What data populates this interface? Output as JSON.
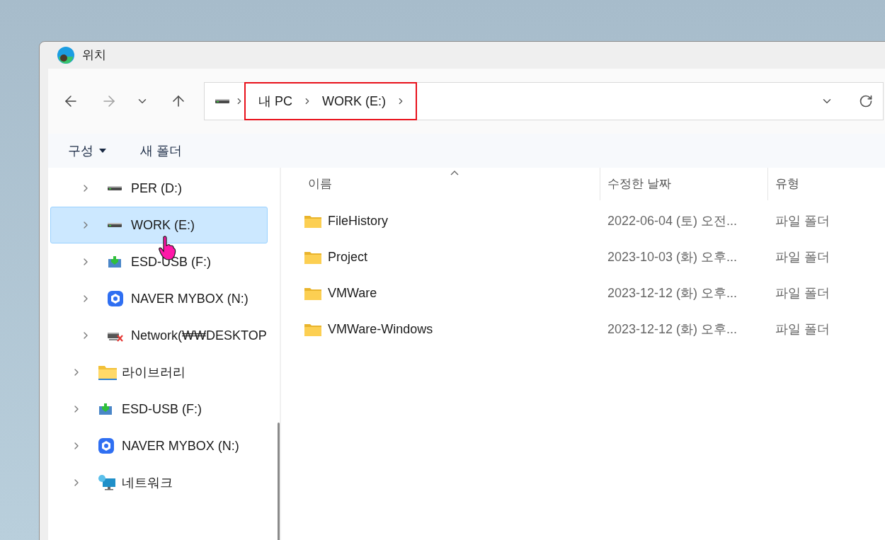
{
  "window": {
    "title": "위치"
  },
  "nav": {
    "back": {
      "disabled": false
    },
    "forward": {
      "disabled": true
    }
  },
  "address_bar": {
    "crumbs": [
      "내 PC",
      "WORK (E:)"
    ]
  },
  "toolbar": {
    "buttons": [
      {
        "label": "구성",
        "kind": "menu"
      },
      {
        "label": "새 폴더",
        "kind": "plain"
      }
    ]
  },
  "sidebar": {
    "items": [
      {
        "children": [
          {
            "label": "PER (D:)",
            "kind": "drive",
            "selected": false,
            "expanded": false
          },
          {
            "label": "WORK (E:)",
            "kind": "drive",
            "selected": true,
            "expanded": false
          },
          {
            "label": "ESD-USB (F:)",
            "kind": "usb",
            "selected": false,
            "expanded": false
          },
          {
            "label": "NAVER MYBOX (N:)",
            "kind": "cloud",
            "selected": false,
            "expanded": false
          },
          {
            "label": "Network(₩₩DESKTOP",
            "kind": "network-drive",
            "selected": false,
            "expanded": false
          }
        ]
      },
      {
        "label": "라이브러리",
        "kind": "library",
        "selected": false,
        "expanded": false
      },
      {
        "label": "ESD-USB (F:)",
        "kind": "usb",
        "selected": false,
        "expanded": false
      },
      {
        "label": "NAVER MYBOX (N:)",
        "kind": "cloud",
        "selected": false,
        "expanded": false
      },
      {
        "label": "네트워크",
        "kind": "network",
        "selected": false,
        "expanded": false
      }
    ]
  },
  "table": {
    "columns": [
      {
        "label": "이름",
        "sorted": true
      },
      {
        "label": "수정한 날짜",
        "sorted": false
      },
      {
        "label": "유형",
        "sorted": false
      }
    ],
    "rows": [
      {
        "name": "FileHistory",
        "modified": "2022-06-04 (토) 오전...",
        "type": "파일 폴더"
      },
      {
        "name": "Project",
        "modified": "2023-10-03 (화) 오후...",
        "type": "파일 폴더"
      },
      {
        "name": "VMWare",
        "modified": "2023-12-12 (화) 오후...",
        "type": "파일 폴더"
      },
      {
        "name": "VMWare-Windows",
        "modified": "2023-12-12 (화) 오후...",
        "type": "파일 폴더"
      }
    ]
  }
}
